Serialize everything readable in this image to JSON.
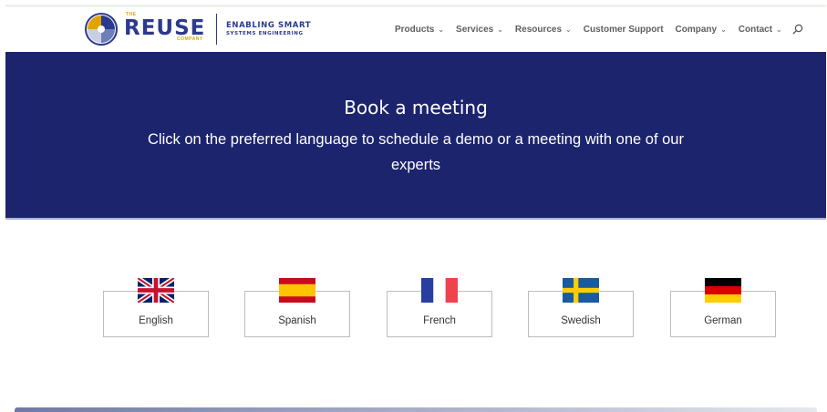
{
  "header": {
    "brand_top": "THE",
    "brand_name": "REUSE",
    "brand_bottom": "COMPANY",
    "tagline_line1": "ENABLING SMART",
    "tagline_line2": "SYSTEMS ENGINEERING",
    "nav": [
      {
        "label": "Products",
        "chevron": "⌄"
      },
      {
        "label": "Services",
        "chevron": "⌄"
      },
      {
        "label": "Resources",
        "chevron": "⌄"
      },
      {
        "label": "Customer Support",
        "chevron": ""
      },
      {
        "label": "Company",
        "chevron": "⌄"
      },
      {
        "label": "Contact",
        "chevron": "⌄"
      }
    ],
    "search_icon": "search-icon"
  },
  "hero": {
    "title": "Book a meeting",
    "subtitle": "Click on the preferred language to schedule a demo or a meeting with one of our experts"
  },
  "languages": [
    {
      "label": "English",
      "flag": "uk-flag-icon"
    },
    {
      "label": "Spanish",
      "flag": "spain-flag-icon"
    },
    {
      "label": "French",
      "flag": "france-flag-icon"
    },
    {
      "label": "Swedish",
      "flag": "sweden-flag-icon"
    },
    {
      "label": "German",
      "flag": "germany-flag-icon"
    }
  ],
  "colors": {
    "hero_bg": "#1c246e",
    "brand_blue": "#2b3a8c",
    "brand_gold": "#e2a300"
  }
}
